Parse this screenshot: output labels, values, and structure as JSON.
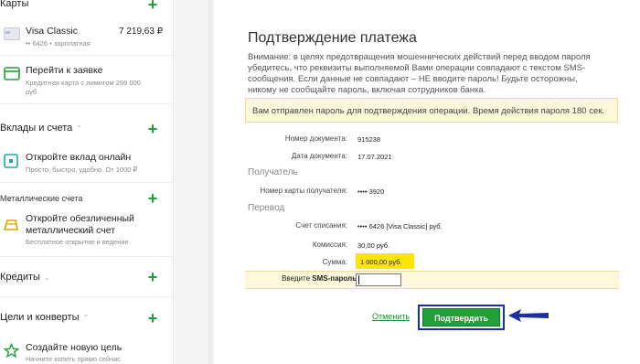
{
  "sidebar": {
    "cards": {
      "title": "Карты"
    },
    "visa": {
      "name": "Visa Classic",
      "amount": "7 219,63 ₽",
      "sub": "•• 6426 • зарплатная"
    },
    "apply": {
      "title": "Перейти к заявке",
      "sub1": "Кредитная карта с лимитом 299 000",
      "sub2": "руб."
    },
    "deposits": {
      "title": "Вклады и счета"
    },
    "open_deposit": {
      "title": "Откройте вклад онлайн",
      "sub": "Просто, быстро, удобно. От 1000 ₽"
    },
    "metal": {
      "title": "Металлические счета",
      "item_title1": "Откройте обезличенный",
      "item_title2": "металлический счет",
      "item_sub": "Бесплатное открытие и ведение"
    },
    "credits": {
      "title": "Кредиты"
    },
    "goals": {
      "title": "Цели и конверты",
      "item_title": "Создайте новую цель",
      "item_sub": "Начните копить прямо сейчас"
    }
  },
  "main": {
    "title": "Подтверждение платежа",
    "warning": "Внимание: в целях предотвращения мошеннических действий перед вводом пароля убедитесь, что реквизиты выполняемой Вами операции совпадают с текстом SMS-сообщения. Если данные не совпадают – НЕ вводите пароль! Будьте осторожны, никому не сообщайте пароль, включая сотрудников банка.",
    "notice": "Вам отправлен пароль для подтверждения операции. Время действия пароля 180 сек.",
    "doc_number_label": "Номер документа:",
    "doc_number": "915238",
    "doc_date_label": "Дата документа:",
    "doc_date": "17.07.2021",
    "recipient_section": "Получатель",
    "recipient_card_label": "Номер карты получателя:",
    "recipient_card": "•••• 3920",
    "transfer_section": "Перевод",
    "account_label": "Счет списания:",
    "account": "•••• 6426  [Visa Classic]  руб.",
    "fee_label": "Комиссия:",
    "fee": "30,00 руб.",
    "sum_label": "Сумма:",
    "sum": "1 000,00  руб.",
    "sms_label_prefix": "Введите ",
    "sms_label_bold": "SMS-пароль :",
    "sms_value": "",
    "cancel": "Отменить",
    "confirm": "Подтвердить"
  },
  "colors": {
    "accent": "#21a038",
    "highlight": "#ffe600",
    "notice_bg": "#fdf8dc",
    "arrow": "#1b2fa0"
  },
  "icons": [
    "plus-icon",
    "card-icon",
    "application-icon",
    "deposit-icon",
    "metal-account-icon",
    "star-icon",
    "chevron-up-icon",
    "chevron-down-icon",
    "arrow-left-icon"
  ]
}
